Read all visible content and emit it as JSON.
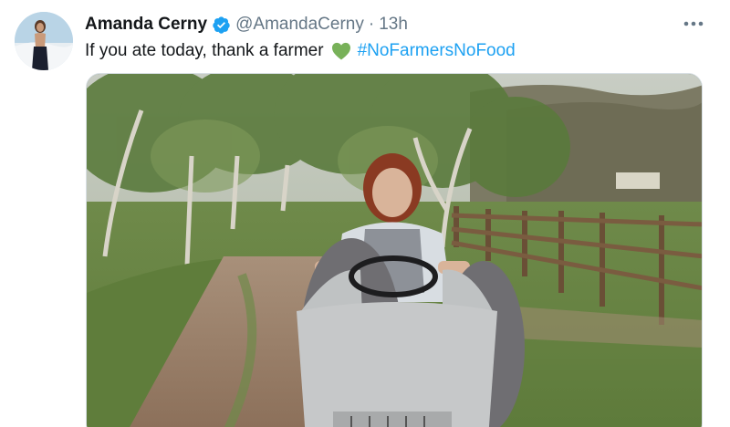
{
  "tweet": {
    "author_name": "Amanda Cerny",
    "author_handle": "@AmandaCerny",
    "separator": "·",
    "timestamp": "13h",
    "text": "If you ate today, thank a farmer",
    "emoji": "green-heart",
    "hashtag": "#NoFarmersNoFood",
    "more_label": "More"
  },
  "icons": {
    "verified": "verified-badge-icon",
    "more": "more-dots-icon",
    "heart": "green-heart-icon"
  },
  "colors": {
    "link": "#1da1f2",
    "verified": "#1da1f2",
    "heart": "#78b159",
    "name": "#14171a",
    "secondary": "#657786"
  }
}
